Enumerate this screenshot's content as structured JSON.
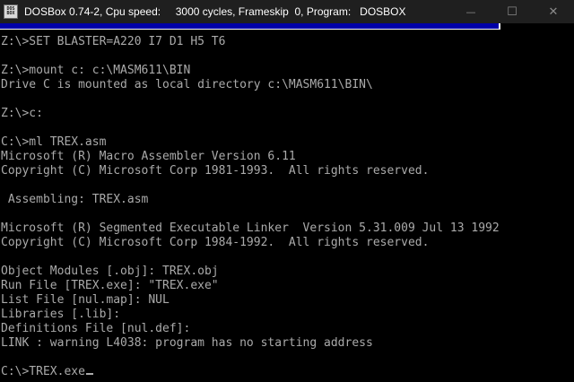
{
  "window": {
    "title": "DOSBox 0.74-2, Cpu speed:     3000 cycles, Frameskip  0, Program:   DOSBOX",
    "icon_label_top": "DOS",
    "icon_label_bottom": "BOX",
    "controls": {
      "minimize_icon": "minimize-icon",
      "maximize_icon": "maximize-icon",
      "close_icon": "close-icon",
      "minimize_glyph": "—",
      "maximize_glyph": "☐",
      "close_glyph": "✕"
    }
  },
  "colors": {
    "titlebar": "#1f1f1f",
    "console_bg": "#000000",
    "console_text": "#aaaaaa",
    "dos_blue": "#0000a8"
  },
  "terminal": {
    "lines": [
      "Z:\\>SET BLASTER=A220 I7 D1 H5 T6",
      "",
      "Z:\\>mount c: c:\\MASM611\\BIN",
      "Drive C is mounted as local directory c:\\MASM611\\BIN\\",
      "",
      "Z:\\>c:",
      "",
      "C:\\>ml TREX.asm",
      "Microsoft (R) Macro Assembler Version 6.11",
      "Copyright (C) Microsoft Corp 1981-1993.  All rights reserved.",
      "",
      " Assembling: TREX.asm",
      "",
      "Microsoft (R) Segmented Executable Linker  Version 5.31.009 Jul 13 1992",
      "Copyright (C) Microsoft Corp 1984-1992.  All rights reserved.",
      "",
      "Object Modules [.obj]: TREX.obj",
      "Run File [TREX.exe]: \"TREX.exe\"",
      "List File [nul.map]: NUL",
      "Libraries [.lib]:",
      "Definitions File [nul.def]:",
      "LINK : warning L4038: program has no starting address",
      "",
      "C:\\>TREX.exe"
    ]
  }
}
